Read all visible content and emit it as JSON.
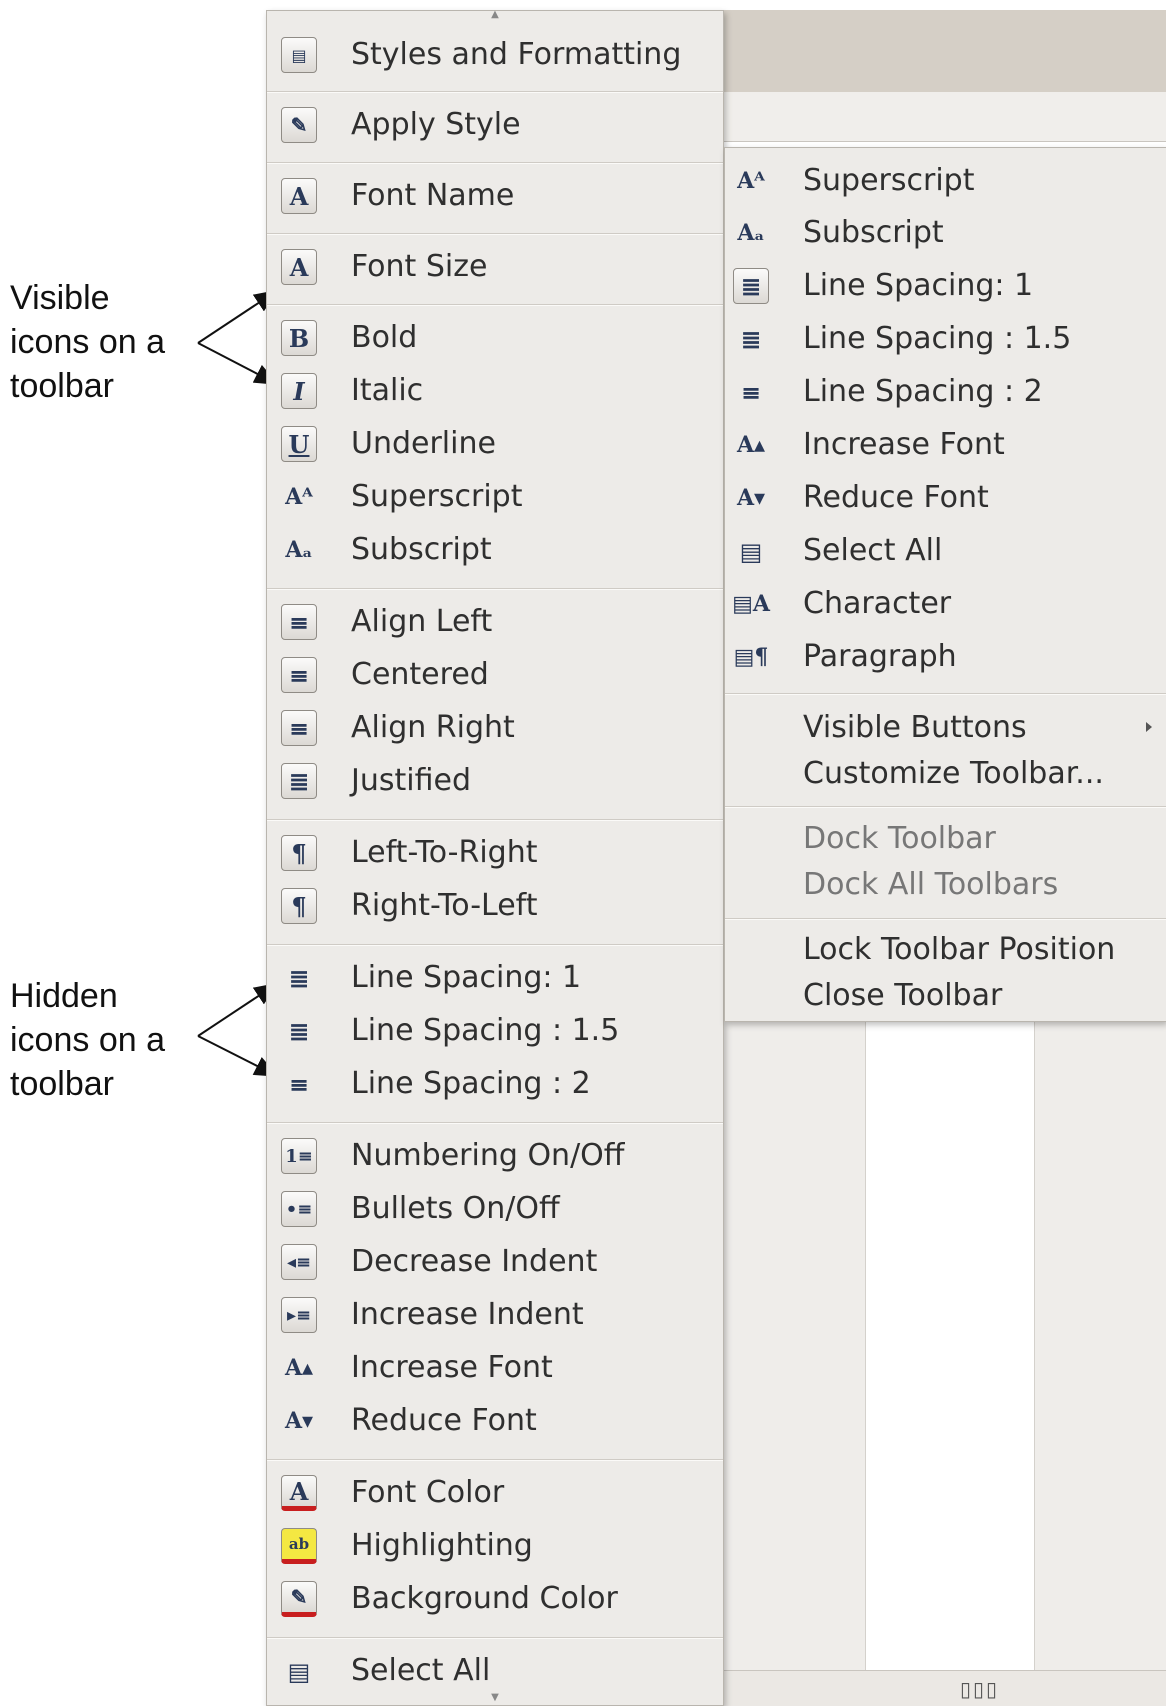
{
  "annotations": {
    "visible": [
      "Visible",
      "icons on a",
      "toolbar"
    ],
    "hidden": [
      "Hidden",
      "icons on a",
      "toolbar"
    ]
  },
  "main_menu": {
    "groups": [
      [
        {
          "label": "Styles and Formatting",
          "icon": "styles-icon"
        }
      ],
      [
        {
          "label": "Apply Style",
          "icon": "apply-style-icon"
        }
      ],
      [
        {
          "label": "Font Name",
          "icon": "font-name-icon"
        }
      ],
      [
        {
          "label": "Font Size",
          "icon": "font-size-icon"
        }
      ],
      [
        {
          "label": "Bold",
          "icon": "bold-icon"
        },
        {
          "label": "Italic",
          "icon": "italic-icon"
        },
        {
          "label": "Underline",
          "icon": "underline-icon"
        },
        {
          "label": "Superscript",
          "icon": "superscript-icon"
        },
        {
          "label": "Subscript",
          "icon": "subscript-icon"
        }
      ],
      [
        {
          "label": "Align Left",
          "icon": "align-left-icon"
        },
        {
          "label": "Centered",
          "icon": "align-center-icon"
        },
        {
          "label": "Align Right",
          "icon": "align-right-icon"
        },
        {
          "label": "Justified",
          "icon": "justify-icon"
        }
      ],
      [
        {
          "label": "Left-To-Right",
          "icon": "left-to-right-icon"
        },
        {
          "label": "Right-To-Left",
          "icon": "right-to-left-icon"
        }
      ],
      [
        {
          "label": "Line Spacing: 1",
          "icon": "line-spacing-1-icon"
        },
        {
          "label": "Line Spacing : 1.5",
          "icon": "line-spacing-15-icon"
        },
        {
          "label": "Line Spacing : 2",
          "icon": "line-spacing-2-icon"
        }
      ],
      [
        {
          "label": "Numbering On/Off",
          "icon": "numbering-icon"
        },
        {
          "label": "Bullets On/Off",
          "icon": "bullets-icon"
        },
        {
          "label": "Decrease Indent",
          "icon": "decrease-indent-icon"
        },
        {
          "label": "Increase Indent",
          "icon": "increase-indent-icon"
        },
        {
          "label": "Increase Font",
          "icon": "increase-font-icon"
        },
        {
          "label": "Reduce Font",
          "icon": "reduce-font-icon"
        }
      ],
      [
        {
          "label": "Font Color",
          "icon": "font-color-icon"
        },
        {
          "label": "Highlighting",
          "icon": "highlighting-icon"
        },
        {
          "label": "Background Color",
          "icon": "background-color-icon"
        }
      ],
      [
        {
          "label": "Select All",
          "icon": "select-all-icon"
        }
      ]
    ]
  },
  "sub_menu": {
    "items": [
      {
        "label": "Superscript",
        "icon": "superscript-icon"
      },
      {
        "label": "Subscript",
        "icon": "subscript-icon"
      },
      {
        "label": "Line Spacing: 1",
        "icon": "line-spacing-1-icon"
      },
      {
        "label": "Line Spacing : 1.5",
        "icon": "line-spacing-15-icon"
      },
      {
        "label": "Line Spacing : 2",
        "icon": "line-spacing-2-icon"
      },
      {
        "label": "Increase Font",
        "icon": "increase-font-icon"
      },
      {
        "label": "Reduce Font",
        "icon": "reduce-font-icon"
      },
      {
        "label": "Select All",
        "icon": "select-all-icon"
      },
      {
        "label": "Character",
        "icon": "character-icon"
      },
      {
        "label": "Paragraph",
        "icon": "paragraph-icon"
      }
    ],
    "visible_buttons": "Visible Buttons",
    "customize_toolbar": "Customize Toolbar...",
    "dock_toolbar": "Dock Toolbar",
    "dock_all_toolbars": "Dock All Toolbars",
    "lock_toolbar_position": "Lock Toolbar Position",
    "close_toolbar": "Close Toolbar"
  }
}
